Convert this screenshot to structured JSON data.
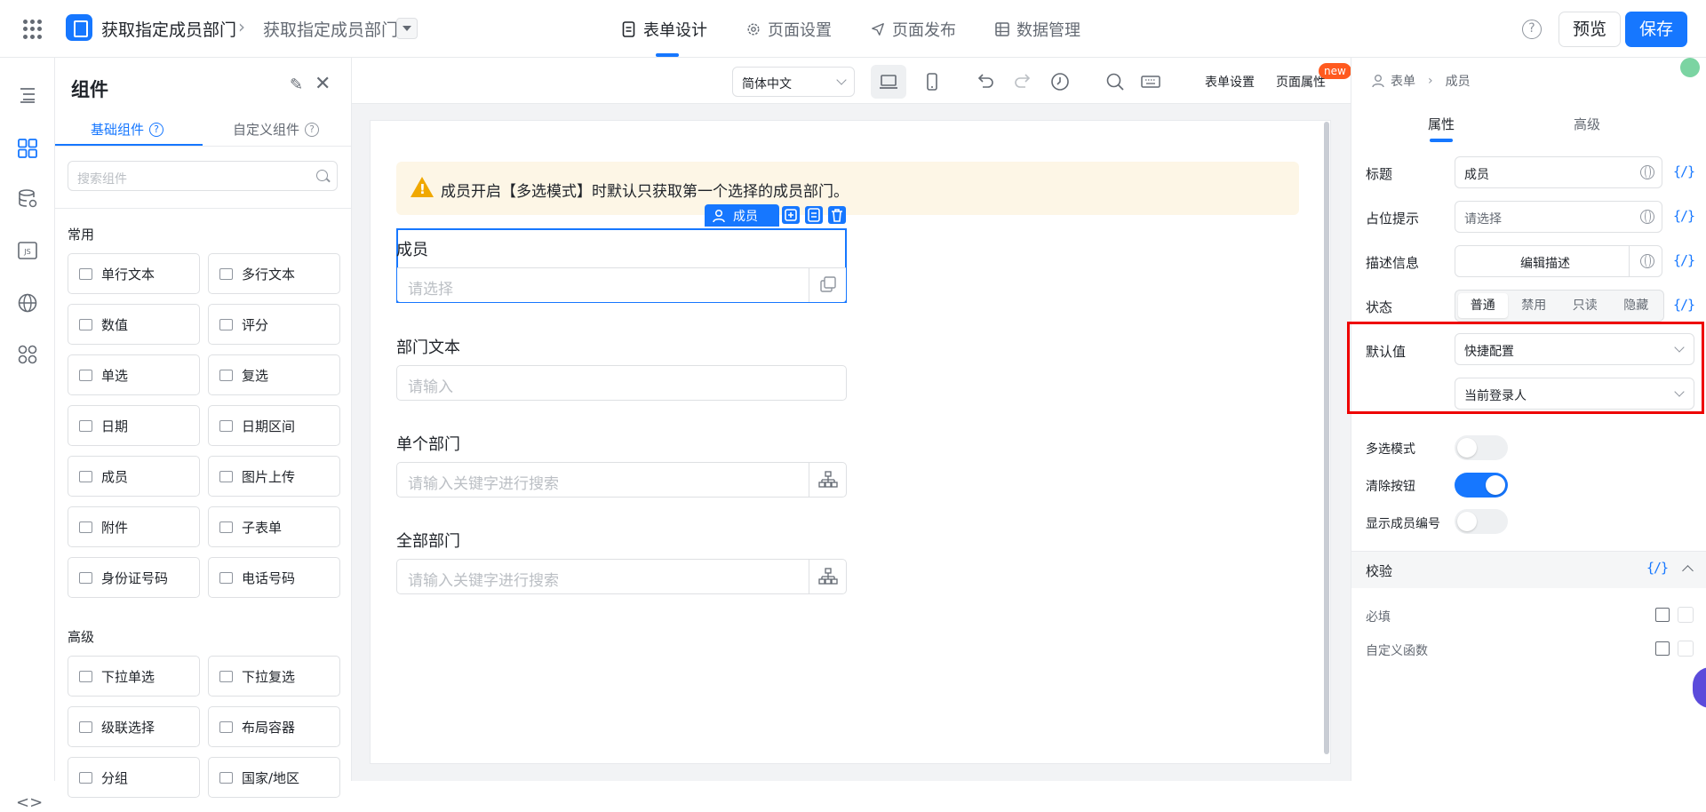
{
  "header": {
    "app_title": "获取指定成员部门",
    "breadcrumb_current": "获取指定成员部门",
    "tabs": [
      {
        "label": "表单设计",
        "icon": "document-icon",
        "active": true
      },
      {
        "label": "页面设置",
        "icon": "gear-icon",
        "active": false
      },
      {
        "label": "页面发布",
        "icon": "send-icon",
        "active": false
      },
      {
        "label": "数据管理",
        "icon": "table-icon",
        "active": false
      }
    ],
    "help": "?",
    "preview_label": "预览",
    "save_label": "保存"
  },
  "components_panel": {
    "title": "组件",
    "tabs": [
      "基础组件",
      "自定义组件"
    ],
    "search_placeholder": "搜索组件",
    "section_common": "常用",
    "common_items": [
      "单行文本",
      "多行文本",
      "数值",
      "评分",
      "单选",
      "复选",
      "日期",
      "日期区间",
      "成员",
      "图片上传",
      "附件",
      "子表单",
      "身份证号码",
      "电话号码"
    ],
    "section_advanced": "高级",
    "advanced_items": [
      "下拉单选",
      "下拉复选",
      "级联选择",
      "布局容器",
      "分组",
      "国家/地区"
    ]
  },
  "canvas_toolbar": {
    "language": "简体中文",
    "form_settings": "表单设置",
    "page_props": "页面属性",
    "new_badge": "new"
  },
  "form": {
    "notice": "成员开启【多选模式】时默认只获取第一个选择的成员部门。",
    "selected_tag": "成员",
    "fields": [
      {
        "label": "成员",
        "placeholder": "请选择"
      },
      {
        "label": "部门文本",
        "placeholder": "请输入"
      },
      {
        "label": "单个部门",
        "placeholder": "请输入关键字进行搜索"
      },
      {
        "label": "全部部门",
        "placeholder": "请输入关键字进行搜索"
      }
    ]
  },
  "props_panel": {
    "breadcrumb": [
      "表单",
      "成员"
    ],
    "tabs": [
      "属性",
      "高级"
    ],
    "title_label": "标题",
    "title_value": "成员",
    "placeholder_label": "占位提示",
    "placeholder_value": "请选择",
    "desc_label": "描述信息",
    "desc_button": "编辑描述",
    "state_label": "状态",
    "state_options": [
      "普通",
      "禁用",
      "只读",
      "隐藏"
    ],
    "default_label": "默认值",
    "default_mode": "快捷配置",
    "default_value": "当前登录人",
    "multi_label": "多选模式",
    "multi_on": false,
    "clear_label": "清除按钮",
    "clear_on": true,
    "show_no_label": "显示成员编号",
    "show_no_on": false,
    "validation_label": "校验",
    "required_label": "必填",
    "custom_fn_label": "自定义函数",
    "fx": "{/}"
  }
}
